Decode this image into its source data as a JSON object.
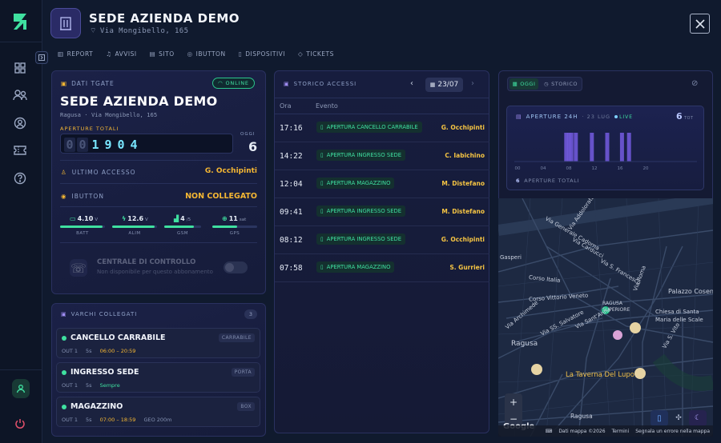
{
  "header": {
    "title": "SEDE AZIENDA DEMO",
    "address": "Via Mongibello, 165"
  },
  "tabs": [
    {
      "label": "REPORT",
      "icon": "chart-icon"
    },
    {
      "label": "AVVISI",
      "icon": "bell-icon"
    },
    {
      "label": "SITO",
      "icon": "building-icon"
    },
    {
      "label": "IBUTTON",
      "icon": "ibutton-icon"
    },
    {
      "label": "DISPOSITIVI",
      "icon": "device-icon"
    },
    {
      "label": "TICKETS",
      "icon": "tag-icon"
    }
  ],
  "tgate": {
    "section_label": "DATI TGATE",
    "status": "ONLINE",
    "name": "SEDE AZIENDA DEMO",
    "location": "Ragusa · Via Mongibello, 165",
    "openings_label": "APERTURE TOTALI",
    "counter_digits": [
      "0",
      "0",
      "1",
      "9",
      "0",
      "4"
    ],
    "today_label": "OGGI",
    "today_value": "6",
    "last_access_label": "ULTIMO ACCESSO",
    "last_access_value": "G. Occhipinti",
    "ibutton_label": "IBUTTON",
    "ibutton_value": "NON COLLEGATO",
    "metrics": [
      {
        "value": "4.10",
        "unit": "V",
        "label": "BATT",
        "level": 0.95
      },
      {
        "value": "12.6",
        "unit": "V",
        "label": "ALIM",
        "level": 0.95
      },
      {
        "value": "4",
        "unit": "/5",
        "label": "GSM",
        "level": 0.8
      },
      {
        "value": "11",
        "unit": "sat",
        "label": "GPS",
        "level": 0.55
      }
    ],
    "control_title": "CENTRALE DI CONTROLLO",
    "control_sub": "Non disponibile per questo abbonamento"
  },
  "gates": {
    "title": "VARCHI COLLEGATI",
    "count": "3",
    "items": [
      {
        "name": "CANCELLO CARRABILE",
        "tag": "CARRABILE",
        "out": "OUT 1",
        "sec": "5s",
        "schedule": "06:00 – 20:59",
        "extra": ""
      },
      {
        "name": "INGRESSO SEDE",
        "tag": "PORTA",
        "out": "OUT 1",
        "sec": "5s",
        "schedule": "Sempre",
        "extra": ""
      },
      {
        "name": "MAGAZZINO",
        "tag": "BOX",
        "out": "OUT 1",
        "sec": "5s",
        "schedule": "07:00 – 18:59",
        "extra": "GEO 200m"
      }
    ]
  },
  "history": {
    "title": "STORICO ACCESSI",
    "date": "23/07",
    "col_time": "Ora",
    "col_event": "Evento",
    "rows": [
      {
        "time": "17:16",
        "event": "APERTURA CANCELLO CARRABILE",
        "user": "G. Occhipinti"
      },
      {
        "time": "14:22",
        "event": "APERTURA INGRESSO SEDE",
        "user": "C. Iabichino"
      },
      {
        "time": "12:04",
        "event": "APERTURA MAGAZZINO",
        "user": "M. Distefano"
      },
      {
        "time": "09:41",
        "event": "APERTURA INGRESSO SEDE",
        "user": "M. Distefano"
      },
      {
        "time": "08:12",
        "event": "APERTURA INGRESSO SEDE",
        "user": "G. Occhipinti"
      },
      {
        "time": "07:58",
        "event": "APERTURA MAGAZZINO",
        "user": "S. Gurrieri"
      }
    ]
  },
  "activity": {
    "toggle_today": "OGGI",
    "toggle_history": "STORICO",
    "title": "APERTURE 24H",
    "date": "· 23 LUG",
    "live": "LIVE",
    "total_value": "6",
    "total_unit": "TOT",
    "footer_value": "6",
    "footer_label": "APERTURE TOTALI",
    "chart_data": {
      "type": "bar",
      "x_ticks": [
        "00",
        "04",
        "08",
        "12",
        "16",
        "20"
      ],
      "bars": [
        {
          "hour": 7.6,
          "value": 1
        },
        {
          "hour": 8.0,
          "value": 1
        },
        {
          "hour": 8.4,
          "value": 1
        },
        {
          "hour": 9.1,
          "value": 1
        },
        {
          "hour": 11.6,
          "value": 1
        },
        {
          "hour": 14.0,
          "value": 1
        },
        {
          "hour": 16.3,
          "value": 1
        },
        {
          "hour": 17.4,
          "value": 1
        }
      ],
      "xlim": [
        0,
        24
      ],
      "ylim": [
        0,
        1
      ]
    }
  },
  "map": {
    "labels": [
      "Via Addolorata",
      "Via Generale Cadorna",
      "Via Carducci",
      "Gasperi",
      "Via S. Francesco",
      "Via Roma",
      "Corso Italia",
      "Palazzo Cosentini",
      "Corso Vittorio Veneto",
      "RAGUSA SUPERIORE",
      "Chiesa di Santa Maria delle Scale",
      "Via Sant'Anna",
      "Via S. Vito",
      "Via Archimede",
      "Via SS. Salvatore",
      "Ragusa",
      "La Taverna Del Lupo",
      "Ragusa"
    ],
    "footer": [
      "Dati mappa ©2026",
      "Termini",
      "Segnala un errore nella mappa"
    ],
    "google": "Google",
    "zoom_in": "+",
    "zoom_out": "−"
  },
  "colors": {
    "accent": "#3fe0a0",
    "warning": "#f5b733",
    "brand": "#4b4c9a"
  }
}
